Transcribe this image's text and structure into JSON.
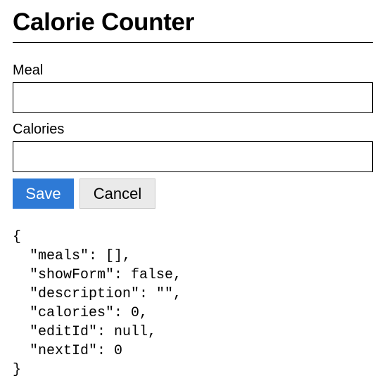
{
  "app": {
    "title": "Calorie Counter"
  },
  "form": {
    "meal_label": "Meal",
    "meal_value": "",
    "calories_label": "Calories",
    "calories_value": "",
    "save_label": "Save",
    "cancel_label": "Cancel"
  },
  "state_dump": {
    "lines": [
      "{",
      "  \"meals\": [],",
      "  \"showForm\": false,",
      "  \"description\": \"\",",
      "  \"calories\": 0,",
      "  \"editId\": null,",
      "  \"nextId\": 0",
      "}"
    ]
  },
  "colors": {
    "accent": "#2e7ad6",
    "cancel_bg": "#eaeaea"
  }
}
